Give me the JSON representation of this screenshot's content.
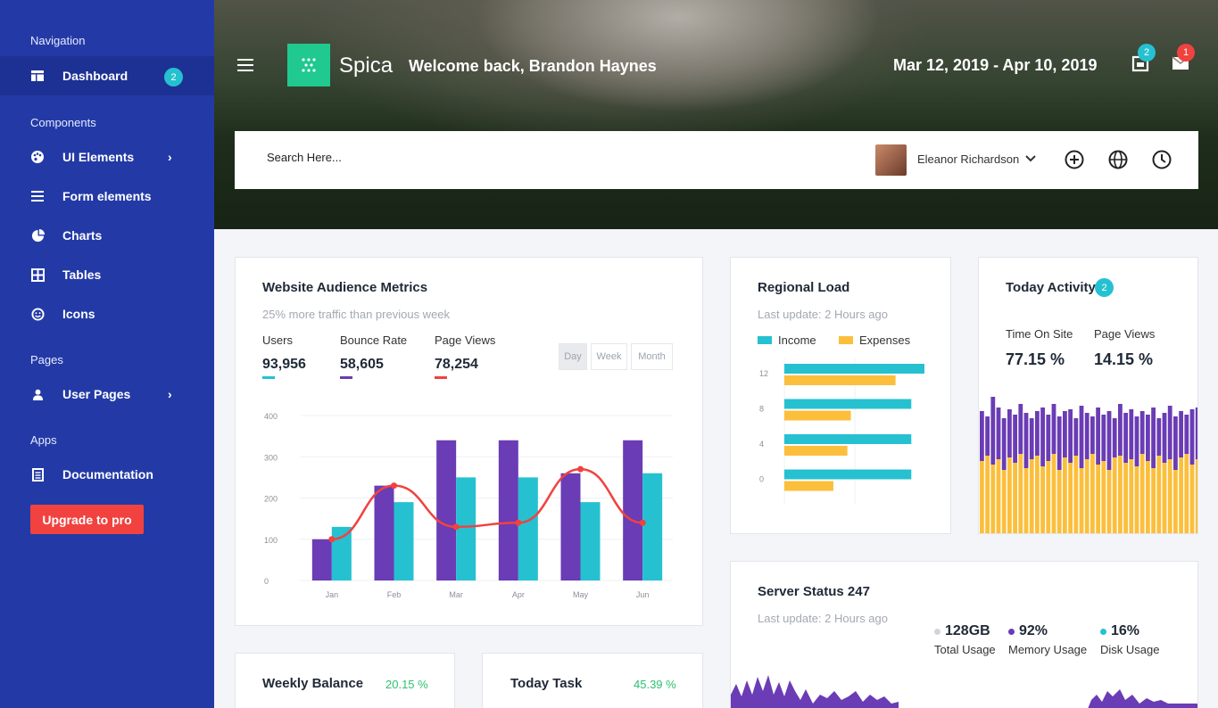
{
  "sidebar": {
    "nav_label": "Navigation",
    "dashboard": {
      "label": "Dashboard",
      "badge": "2"
    },
    "components_label": "Components",
    "components": [
      {
        "label": "UI Elements"
      },
      {
        "label": "Form elements"
      },
      {
        "label": "Charts"
      },
      {
        "label": "Tables"
      },
      {
        "label": "Icons"
      }
    ],
    "pages_label": "Pages",
    "user_pages": "User Pages",
    "apps_label": "Apps",
    "documentation": "Documentation",
    "upgrade": "Upgrade to pro"
  },
  "header": {
    "brand": "Spica",
    "welcome": "Welcome back, Brandon Haynes",
    "date_range": "Mar 12, 2019 - Apr 10, 2019",
    "notifications_count": "2",
    "messages_count": "1",
    "search_placeholder": "Search Here...",
    "user_name": "Eleanor Richardson"
  },
  "audience": {
    "title": "Website Audience Metrics",
    "subtitle": "25% more traffic than previous week",
    "metrics": [
      {
        "label": "Users",
        "value": "93,956",
        "color": "#25c1d1"
      },
      {
        "label": "Bounce Rate",
        "value": "58,605",
        "color": "#6a3cb5"
      },
      {
        "label": "Page Views",
        "value": "78,254",
        "color": "#f1423f"
      }
    ],
    "periods": [
      "Day",
      "Week",
      "Month"
    ]
  },
  "regional": {
    "title": "Regional Load",
    "subtitle": "Last update: 2 Hours ago",
    "legend": [
      "Income",
      "Expenses"
    ]
  },
  "activity": {
    "title": "Today Activity",
    "badge": "2",
    "time_on_site_label": "Time On Site",
    "time_on_site": "77.15 %",
    "page_views_label": "Page Views",
    "page_views": "14.15 %"
  },
  "server": {
    "title": "Server Status 247",
    "subtitle": "Last update: 2 Hours ago",
    "stats": [
      {
        "value": "128GB",
        "label": "Total Usage",
        "color": "#d1d5db"
      },
      {
        "value": "92%",
        "label": "Memory Usage",
        "color": "#6a3cb5"
      },
      {
        "value": "16%",
        "label": "Disk Usage",
        "color": "#25c1d1"
      }
    ]
  },
  "weekly": {
    "title": "Weekly Balance",
    "pct": "20.15 %"
  },
  "task": {
    "title": "Today Task",
    "pct": "45.39 %"
  },
  "chart_data": [
    {
      "type": "bar",
      "categories": [
        "Jan",
        "Feb",
        "Mar",
        "Apr",
        "May",
        "Jun"
      ],
      "ylim": [
        0,
        400
      ],
      "yticks": [
        "0",
        "100",
        "200",
        "300",
        "400"
      ],
      "series": [
        {
          "values": [
            100,
            230,
            340,
            340,
            260,
            340
          ],
          "color": "#6a3cb5"
        },
        {
          "values": [
            130,
            190,
            250,
            250,
            190,
            260
          ],
          "color": "#25c1d1"
        },
        {
          "values": [
            100,
            230,
            130,
            140,
            270,
            140
          ],
          "color": "#f1423f",
          "kind": "line"
        }
      ]
    },
    {
      "type": "bar",
      "orientation": "horizontal",
      "categories": [
        "12",
        "8",
        "4",
        "0"
      ],
      "series": [
        {
          "name": "Income",
          "values": [
            16,
            14.5,
            14.5,
            14.5
          ],
          "color": "#25c1d1"
        },
        {
          "name": "Expenses",
          "values": [
            12.7,
            7.6,
            7.2,
            5.6
          ],
          "color": "#fbbf3c"
        }
      ],
      "xlim": [
        0,
        16
      ]
    }
  ]
}
